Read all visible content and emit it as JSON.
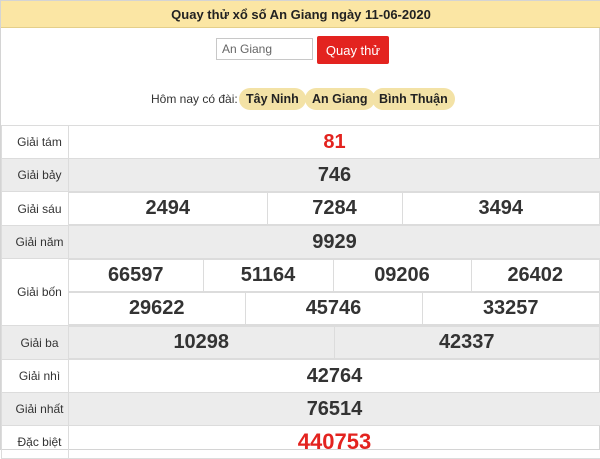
{
  "header": {
    "title": "Quay thử xổ số An Giang ngày 11-06-2020"
  },
  "controls": {
    "province_value": "An Giang",
    "spin_label": "Quay thử"
  },
  "today": {
    "label": "Hôm nay có đài:",
    "stations": [
      "Tây Ninh",
      "An Giang",
      "Bình Thuận"
    ]
  },
  "prizes": {
    "g8": {
      "label": "Giải tám",
      "numbers": [
        "81"
      ]
    },
    "g7": {
      "label": "Giải bảy",
      "numbers": [
        "746"
      ]
    },
    "g6": {
      "label": "Giải sáu",
      "numbers": [
        "2494",
        "7284",
        "3494"
      ]
    },
    "g5": {
      "label": "Giải năm",
      "numbers": [
        "9929"
      ]
    },
    "g4": {
      "label": "Giải bốn",
      "numbers": [
        "66597",
        "51164",
        "09206",
        "26402",
        "29622",
        "45746",
        "33257"
      ]
    },
    "g3": {
      "label": "Giải ba",
      "numbers": [
        "10298",
        "42337"
      ]
    },
    "g2": {
      "label": "Giải nhì",
      "numbers": [
        "42764"
      ]
    },
    "g1": {
      "label": "Giải nhất",
      "numbers": [
        "76514"
      ]
    },
    "db": {
      "label": "Đặc biệt",
      "numbers": [
        "440753"
      ]
    }
  },
  "colors": {
    "accent_red": "#e3231f",
    "header_bg": "#fbe6a4",
    "pill_bg": "#f3e2a6",
    "shade_row": "#ececec"
  }
}
